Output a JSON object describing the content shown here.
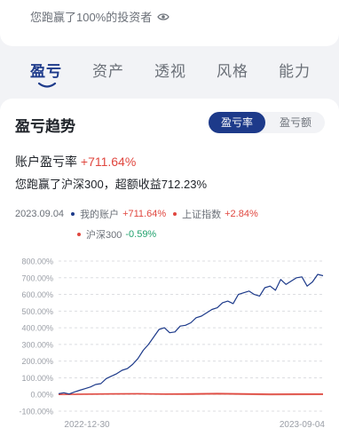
{
  "header": {
    "beat_text": "您跑赢了100%的投资者",
    "beat_icon": "eye-icon"
  },
  "tabs": [
    {
      "label": "盈亏",
      "active": true
    },
    {
      "label": "资产",
      "active": false
    },
    {
      "label": "透视",
      "active": false
    },
    {
      "label": "风格",
      "active": false
    },
    {
      "label": "能力",
      "active": false
    }
  ],
  "section": {
    "title": "盈亏趋势",
    "toggle": {
      "rate_label": "盈亏率",
      "amount_label": "盈亏额",
      "selected": "盈亏率"
    },
    "rate_label": "账户盈亏率",
    "rate_value": "+711.64%",
    "beat_index_text": "您跑赢了沪深300，超额收益712.23%"
  },
  "legend": {
    "date": "2023.09.04",
    "items": [
      {
        "name": "我的账户",
        "value": "+711.64%",
        "color": "#1d3a8a",
        "value_color": "#e0473f"
      },
      {
        "name": "上证指数",
        "value": "+2.84%",
        "color": "#e0473f",
        "value_color": "#e0473f"
      },
      {
        "name": "沪深300",
        "value": "-0.59%",
        "color": "#e0473f",
        "value_color": "#22a26e"
      }
    ]
  },
  "chart_data": {
    "type": "line",
    "y_ticks": [
      "800.00%",
      "700.00%",
      "600.00%",
      "500.00%",
      "400.00%",
      "300.00%",
      "200.00%",
      "100.00%",
      "0.00%",
      "-100.00%"
    ],
    "ylim": [
      -100,
      800
    ],
    "x_tick_labels": [
      "2022-12-30",
      "2023-09-04"
    ],
    "grid": true,
    "series": [
      {
        "name": "我的账户",
        "color": "#1d3a8a",
        "x": [
          0,
          2,
          4,
          6,
          8,
          10,
          12,
          14,
          16,
          18,
          20,
          22,
          24,
          26,
          28,
          30,
          32,
          34,
          36,
          38,
          40,
          42,
          44,
          46,
          48,
          50,
          52,
          54,
          56,
          58,
          60,
          62,
          64,
          66,
          68,
          70,
          72,
          74,
          76,
          78,
          80,
          82,
          84,
          86,
          88,
          90,
          92,
          94,
          96,
          98,
          100
        ],
        "values": [
          5,
          10,
          3,
          15,
          25,
          35,
          45,
          60,
          65,
          95,
          110,
          125,
          145,
          155,
          180,
          215,
          265,
          300,
          345,
          390,
          400,
          370,
          375,
          410,
          415,
          430,
          460,
          470,
          490,
          510,
          520,
          550,
          560,
          545,
          600,
          610,
          620,
          600,
          590,
          640,
          650,
          625,
          690,
          660,
          680,
          700,
          705,
          650,
          675,
          720,
          712
        ]
      },
      {
        "name": "上证指数",
        "color": "#e0473f",
        "x": [
          0,
          10,
          20,
          30,
          40,
          50,
          60,
          70,
          80,
          90,
          100
        ],
        "values": [
          0,
          2,
          4,
          5,
          3,
          4,
          6,
          4,
          2,
          3,
          2.84
        ]
      },
      {
        "name": "沪深300",
        "color": "#e38a7e",
        "x": [
          0,
          10,
          20,
          30,
          40,
          50,
          60,
          70,
          80,
          90,
          100
        ],
        "values": [
          0,
          1,
          2,
          3,
          1,
          0,
          2,
          0,
          -2,
          -1,
          -0.59
        ]
      }
    ]
  }
}
